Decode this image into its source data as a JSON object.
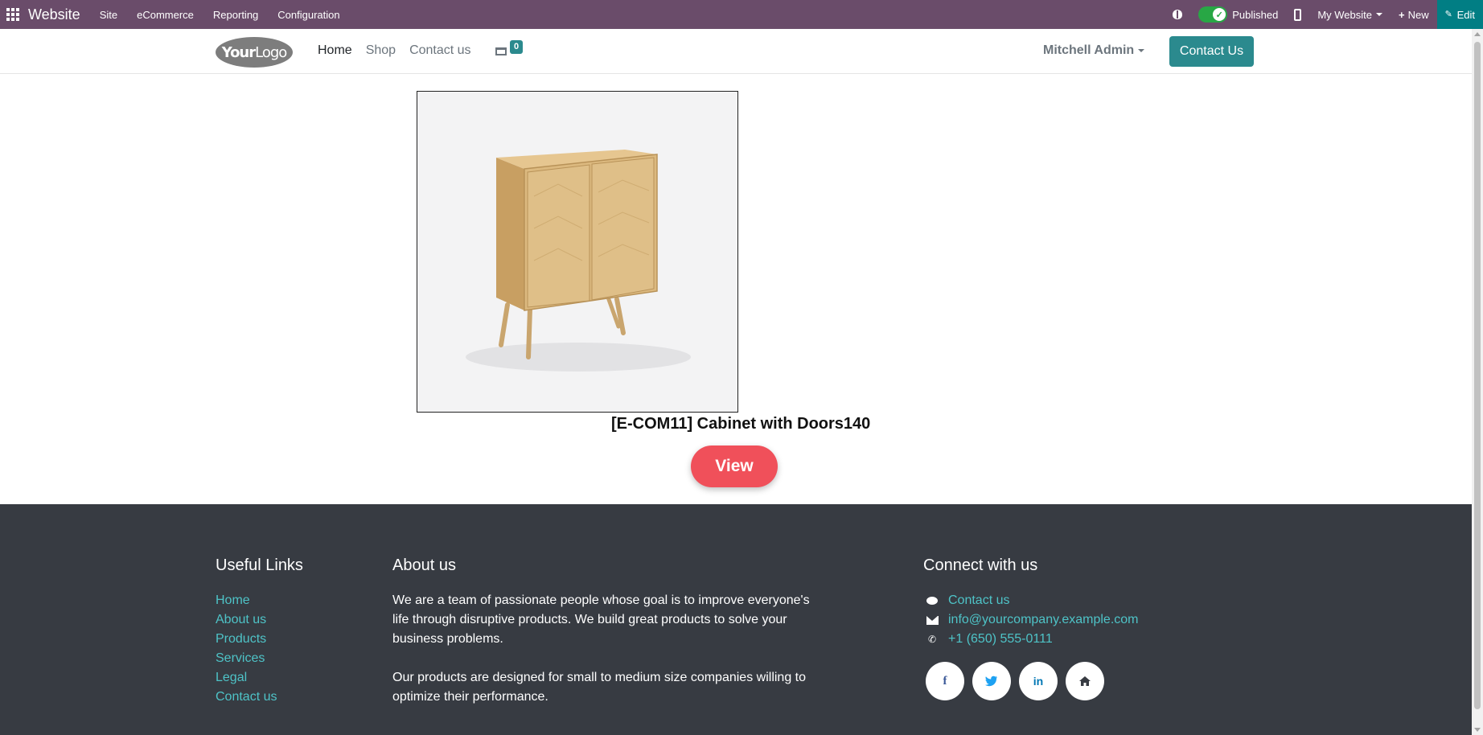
{
  "admin_bar": {
    "app_name": "Website",
    "menu": [
      "Site",
      "eCommerce",
      "Reporting",
      "Configuration"
    ],
    "published_label": "Published",
    "website_selector": "My Website",
    "new_label": "New",
    "edit_label": "Edit",
    "bg_color": "#6a4c6a",
    "edit_bg_color": "#017e84"
  },
  "header": {
    "logo_text_bold": "Your",
    "logo_text_light": "Logo",
    "nav": [
      "Home",
      "Shop",
      "Contact us"
    ],
    "cart_count": "0",
    "user": "Mitchell Admin",
    "contact_button": "Contact Us",
    "accent_color": "#2b8a8e"
  },
  "product": {
    "name": "[E-COM11] Cabinet with Doors140",
    "view_button": "View",
    "view_color": "#f0505a"
  },
  "footer": {
    "useful_links_title": "Useful Links",
    "useful_links": [
      "Home",
      "About us",
      "Products",
      "Services",
      "Legal",
      "Contact us"
    ],
    "about_title": "About us",
    "about_p1": "We are a team of passionate people whose goal is to improve everyone's life through disruptive products. We build great products to solve your business problems.",
    "about_p2": "Our products are designed for small to medium size companies willing to optimize their performance.",
    "connect_title": "Connect with us",
    "contact_link": "Contact us",
    "email": "info@yourcompany.example.com",
    "phone": "+1 (650) 555-0111",
    "social_icons": [
      "facebook-icon",
      "twitter-icon",
      "linkedin-icon",
      "home-icon"
    ],
    "bg_color": "#373b42",
    "link_color": "#4ec3c7"
  }
}
